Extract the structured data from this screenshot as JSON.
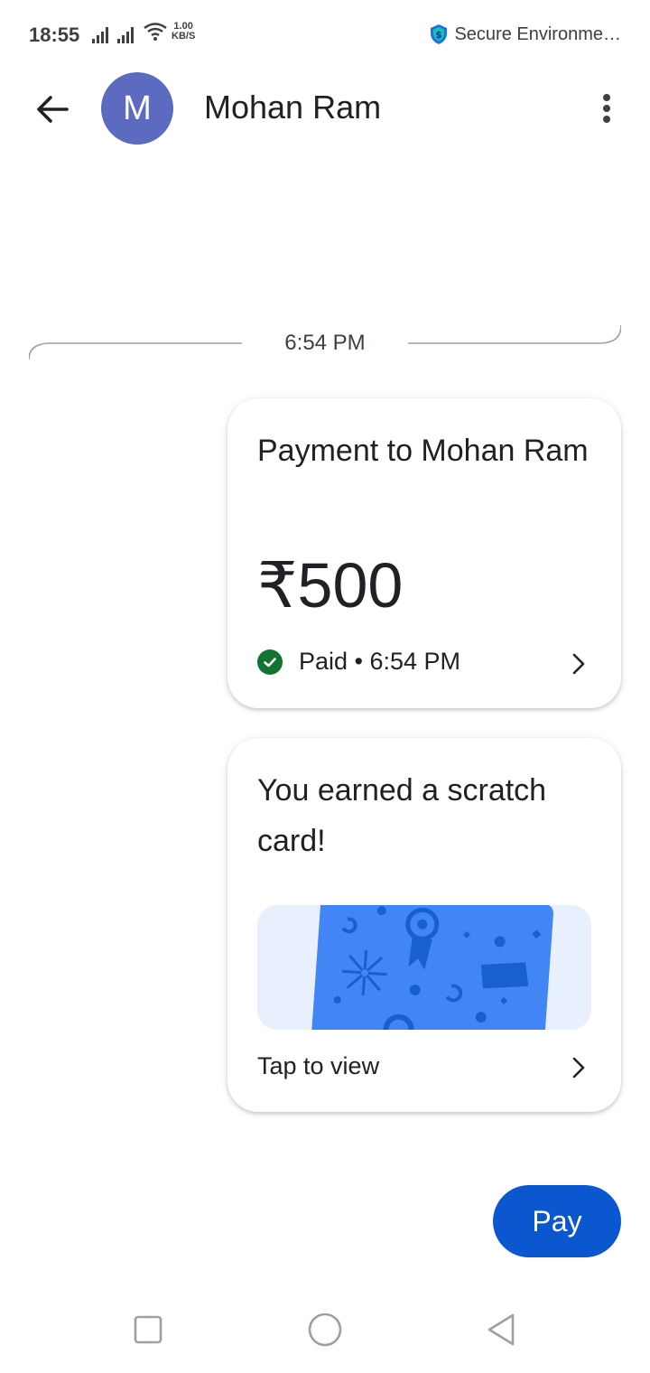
{
  "status_bar": {
    "time": "18:55",
    "speed_value": "1.00",
    "speed_unit": "KB/S",
    "secure_label": "Secure Environme…",
    "icons": [
      "signal-icon",
      "signal-icon",
      "wifi-icon",
      "shield-dollar-icon"
    ]
  },
  "header": {
    "avatar_initial": "M",
    "contact_name": "Mohan Ram",
    "back_icon": "arrow-left-icon",
    "menu_icon": "more-vert-icon"
  },
  "conversation": {
    "timestamp": "6:54 PM",
    "payment_card": {
      "title": "Payment to Mohan Ram",
      "amount": "₹500",
      "status": "Paid • 6:54 PM",
      "status_icon": "check-circle-icon",
      "status_color": "#137333"
    },
    "scratch_card": {
      "title": "You earned a scratch card!",
      "action": "Tap to view",
      "card_color": "#4285f4"
    }
  },
  "pay_button": {
    "label": "Pay",
    "color": "#0b57d0"
  },
  "nav_bar": {
    "icons": [
      "recents-square-icon",
      "home-circle-icon",
      "back-triangle-icon"
    ]
  }
}
